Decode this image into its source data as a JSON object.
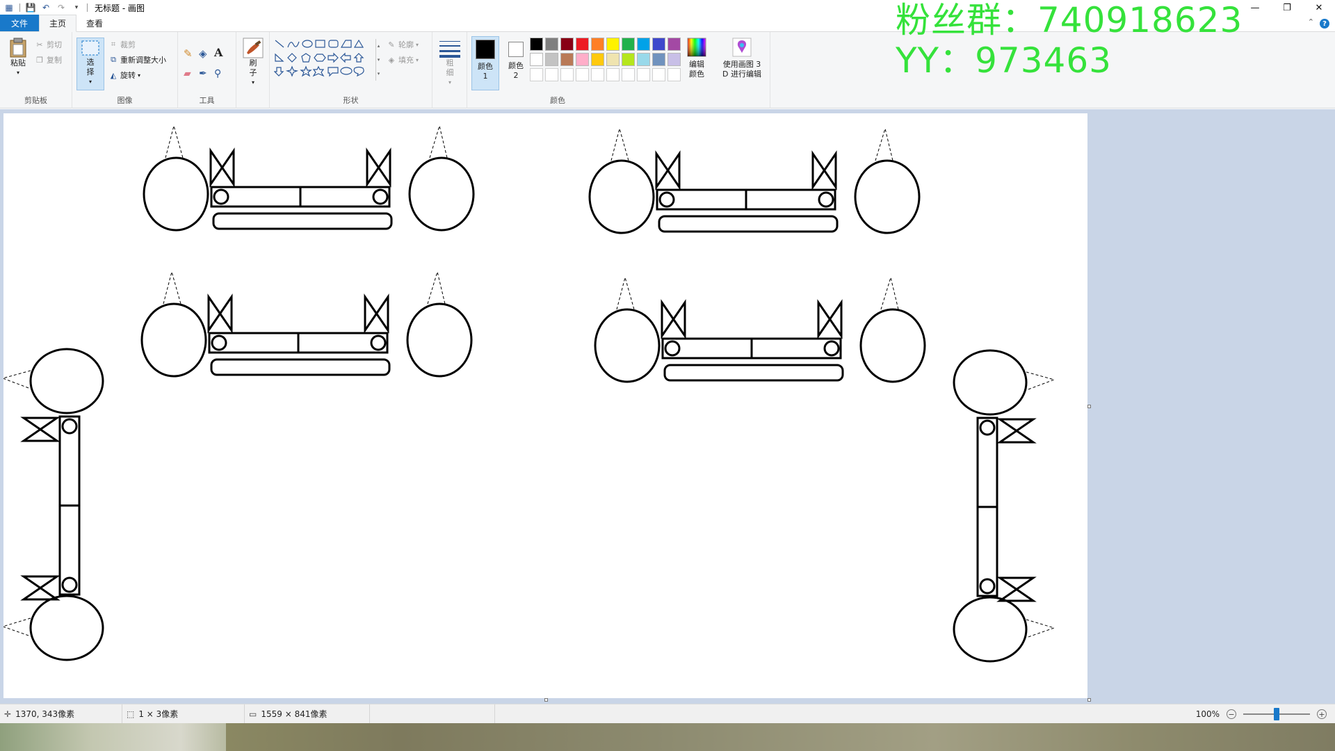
{
  "title_bar": {
    "title": "无标题 - 画图",
    "window_buttons": [
      "—",
      "❐",
      "✕"
    ]
  },
  "overlay": {
    "line1": "粉丝群：740918623",
    "line2": "YY：973463"
  },
  "tabs": {
    "file": "文件",
    "home": "主页",
    "view": "查看"
  },
  "ribbon": {
    "clipboard": {
      "label": "剪贴板",
      "paste": "粘贴",
      "cut": "剪切",
      "copy": "复制"
    },
    "image": {
      "label": "图像",
      "select": "选择",
      "crop": "裁剪",
      "resize": "重新调整大小",
      "rotate": "旋转"
    },
    "tools": {
      "label": "工具"
    },
    "brushes": {
      "label": "刷子"
    },
    "shapes": {
      "label": "形状",
      "outline": "轮廓",
      "fill": "填充"
    },
    "size": {
      "label": "粗细"
    },
    "colors": {
      "label": "颜色",
      "color1": "颜色 1",
      "color2": "颜色 2",
      "edit_colors": "编辑颜色",
      "paint3d": "使用画图 3 D 进行编辑",
      "color1_value": "#000000",
      "color2_value": "#ffffff",
      "palette_row1": [
        "#000000",
        "#7f7f7f",
        "#880015",
        "#ed1c24",
        "#ff7f27",
        "#fff200",
        "#22b14c",
        "#00a2e8",
        "#3f48cc",
        "#a349a4"
      ],
      "palette_row2": [
        "#ffffff",
        "#c3c3c3",
        "#b97a57",
        "#ffaec9",
        "#ffc90e",
        "#efe4b0",
        "#b5e61d",
        "#99d9ea",
        "#7092be",
        "#c8bfe7"
      ],
      "palette_row3": [
        "#ffffff",
        "#ffffff",
        "#ffffff",
        "#ffffff",
        "#ffffff",
        "#ffffff",
        "#ffffff",
        "#ffffff",
        "#ffffff",
        "#ffffff"
      ]
    }
  },
  "status": {
    "cursor_pos": "1370, 343像素",
    "selection_size": "1 × 3像素",
    "canvas_size": "1559 × 841像素",
    "zoom": "100%"
  }
}
